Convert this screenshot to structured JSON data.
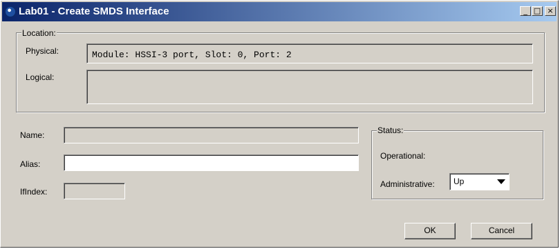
{
  "window": {
    "title": "Lab01 - Create SMDS Interface",
    "controls": {
      "minimize": "_",
      "maximize": "□",
      "close": "×"
    }
  },
  "location": {
    "legend": "Location:",
    "physical_label": "Physical:",
    "physical_value": "Module: HSSI-3 port, Slot: 0, Port: 2",
    "logical_label": "Logical:",
    "logical_value": ""
  },
  "form": {
    "name_label": "Name:",
    "name_value": "",
    "alias_label": "Alias:",
    "alias_value": "",
    "ifindex_label": "IfIndex:",
    "ifindex_value": ""
  },
  "status": {
    "legend": "Status:",
    "operational_label": "Operational:",
    "operational_value": "",
    "administrative_label": "Administrative:",
    "administrative_value": "Up"
  },
  "buttons": {
    "ok": "OK",
    "cancel": "Cancel"
  }
}
